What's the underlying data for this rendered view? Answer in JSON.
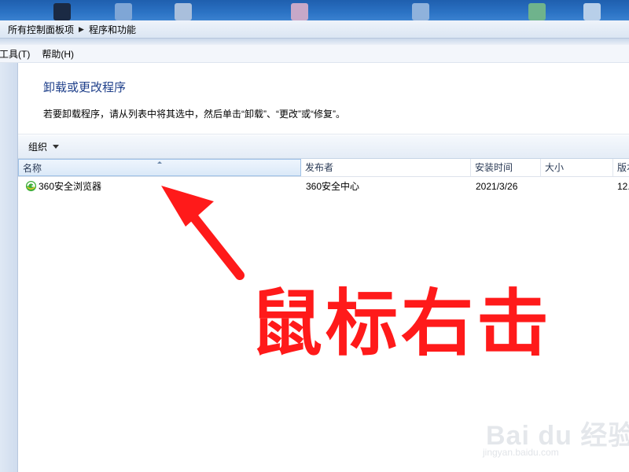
{
  "breadcrumb": [
    "所有控制面板项",
    "程序和功能"
  ],
  "menu": [
    "工具(T)",
    "帮助(H)"
  ],
  "page": {
    "heading": "卸载或更改程序",
    "description": "若要卸载程序，请从列表中将其选中，然后单击“卸载”、“更改”或“修复”。"
  },
  "toolbar": {
    "organize_label": "组织"
  },
  "columns": [
    "名称",
    "发布者",
    "安装时间",
    "大小",
    "版本"
  ],
  "rows": [
    {
      "name": "360安全浏览器",
      "publisher": "360安全中心",
      "installed": "2021/3/26",
      "size": "",
      "version": "12."
    }
  ],
  "annotation": {
    "text": "鼠标右击",
    "color": "#ff1a1a"
  },
  "watermark": {
    "main": "Bai du 经验",
    "sub": "jingyan.baidu.com"
  },
  "icons": {
    "breadcrumb_sep": "chevron-right-icon",
    "organize_caret": "chevron-down-icon",
    "app": "360-browser-icon",
    "annotation": "red-arrow-icon"
  }
}
